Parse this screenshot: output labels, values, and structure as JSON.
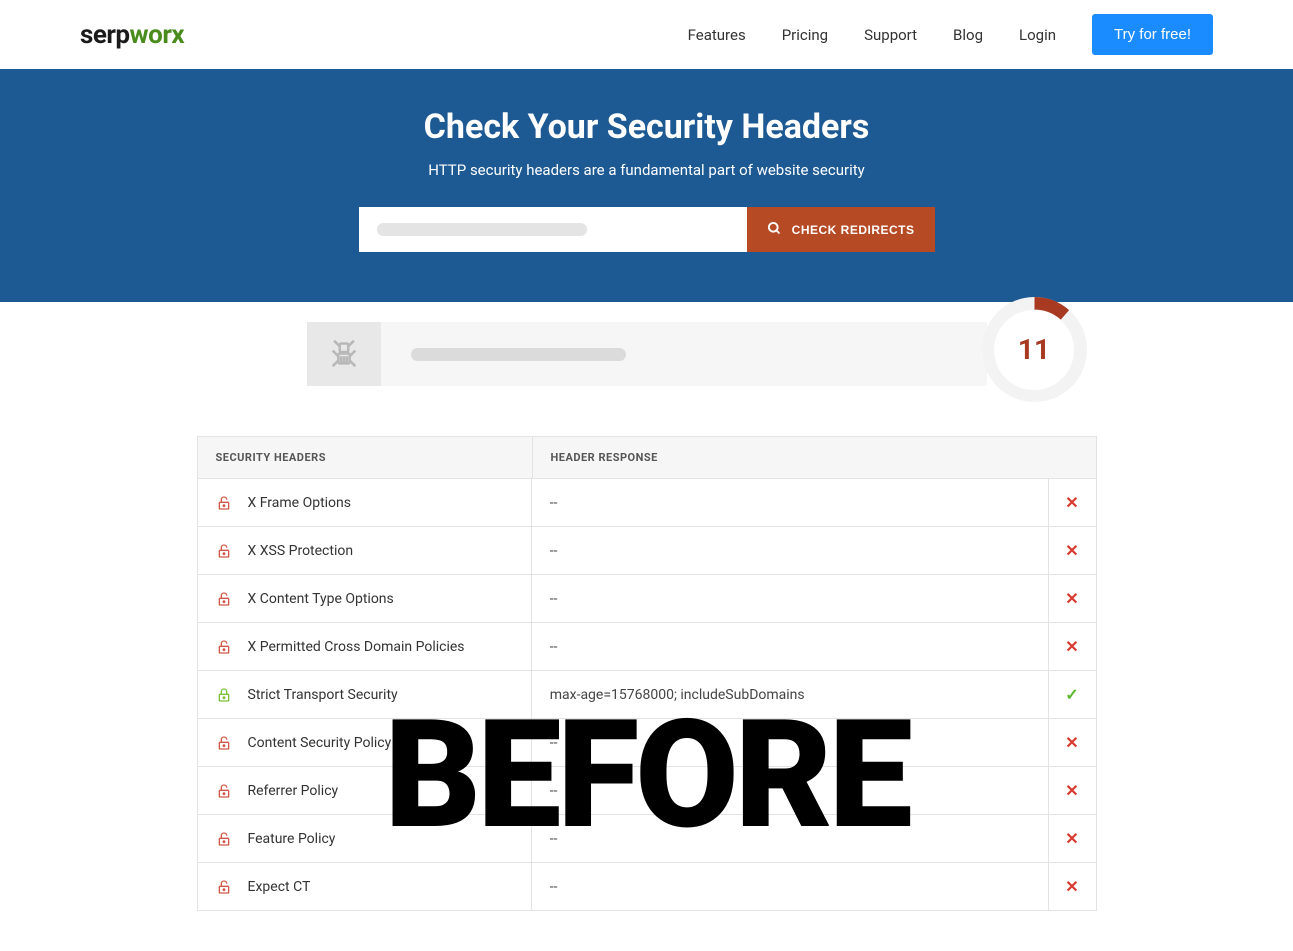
{
  "logo": {
    "part1": "serp",
    "part2": "worx"
  },
  "nav": {
    "features": "Features",
    "pricing": "Pricing",
    "support": "Support",
    "blog": "Blog",
    "login": "Login",
    "cta": "Try for free!"
  },
  "hero": {
    "title": "Check Your Security Headers",
    "subtitle": "HTTP security headers are a fundamental part of website security",
    "button": "CHECK REDIRECTS"
  },
  "score": {
    "value": "11"
  },
  "table": {
    "header1": "SECURITY HEADERS",
    "header2": "HEADER RESPONSE",
    "rows": [
      {
        "name": "X Frame Options",
        "response": "--",
        "status": "fail"
      },
      {
        "name": "X XSS Protection",
        "response": "--",
        "status": "fail"
      },
      {
        "name": "X Content Type Options",
        "response": "--",
        "status": "fail"
      },
      {
        "name": "X Permitted Cross Domain Policies",
        "response": "--",
        "status": "fail"
      },
      {
        "name": "Strict Transport Security",
        "response": "max-age=15768000; includeSubDomains",
        "status": "pass"
      },
      {
        "name": "Content Security Policy",
        "response": "--",
        "status": "fail"
      },
      {
        "name": "Referrer Policy",
        "response": "--",
        "status": "fail"
      },
      {
        "name": "Feature Policy",
        "response": "--",
        "status": "fail"
      },
      {
        "name": "Expect CT",
        "response": "--",
        "status": "fail"
      }
    ]
  },
  "watermark": "BEFORE"
}
